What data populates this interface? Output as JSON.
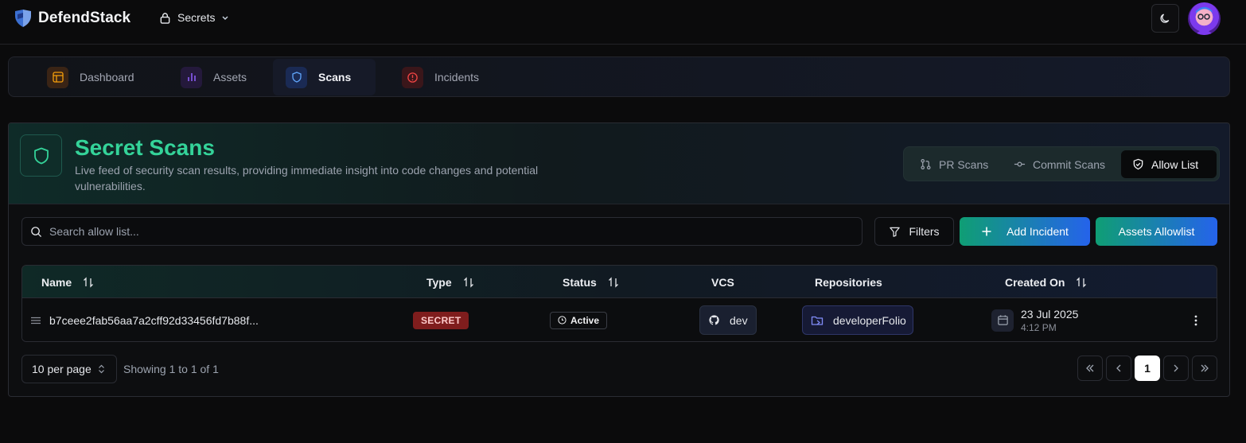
{
  "app": {
    "brand": "DefendStack",
    "workspace": "Secrets"
  },
  "nav": {
    "tabs": [
      {
        "label": "Dashboard",
        "icon": "layout-icon",
        "color": "#f59e0b"
      },
      {
        "label": "Assets",
        "icon": "bar-chart-icon",
        "color": "#8b5cf6"
      },
      {
        "label": "Scans",
        "icon": "shield-icon",
        "color": "#3b82f6",
        "active": true
      },
      {
        "label": "Incidents",
        "icon": "alert-circle-icon",
        "color": "#ef4444"
      }
    ]
  },
  "hero": {
    "title": "Secret Scans",
    "description": "Live feed of security scan results, providing immediate insight into code changes and potential vulnerabilities.",
    "segments": [
      {
        "label": "PR Scans",
        "icon": "git-pull-request-icon"
      },
      {
        "label": "Commit Scans",
        "icon": "git-commit-icon"
      },
      {
        "label": "Allow List",
        "icon": "shield-check-icon",
        "active": true
      }
    ]
  },
  "toolbar": {
    "search_placeholder": "Search allow list...",
    "filters_label": "Filters",
    "add_incident_label": "Add Incident",
    "assets_allowlist_label": "Assets Allowlist"
  },
  "table": {
    "columns": [
      "Name",
      "Type",
      "Status",
      "VCS",
      "Repositories",
      "Created On"
    ],
    "rows": [
      {
        "name": "b7ceee2fab56aa7a2cff92d33456fd7b88f...",
        "type": "SECRET",
        "status": "Active",
        "vcs": "dev",
        "repository": "developerFolio",
        "created_date": "23 Jul 2025",
        "created_time": "4:12 PM"
      }
    ]
  },
  "pagination": {
    "per_page": "10 per page",
    "showing": "Showing 1 to 1 of 1",
    "current_page": "1"
  },
  "colors": {
    "accent_green": "#34d399",
    "brand_gradient_start": "#0f9e74",
    "brand_gradient_end": "#2563eb",
    "secret_badge": "#7f1d1d"
  }
}
